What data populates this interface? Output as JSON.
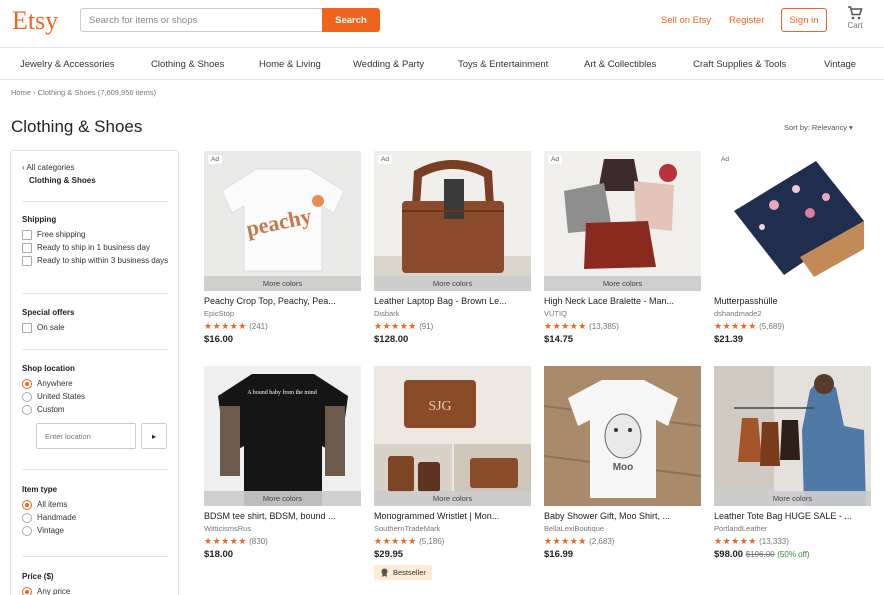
{
  "header": {
    "logo": "Etsy",
    "search_placeholder": "Search for items or shops",
    "search_button": "Search",
    "sell_on_etsy": "Sell on Etsy",
    "register": "Register",
    "sign_in": "Sign in",
    "cart_label": "Cart",
    "cart_icon": "cart-icon"
  },
  "categories": [
    "Jewelry & Accessories",
    "Clothing & Shoes",
    "Home & Living",
    "Wedding & Party",
    "Toys & Entertainment",
    "Art & Collectibles",
    "Craft Supplies & Tools",
    "Vintage"
  ],
  "breadcrumb": "Home › Clothing & Shoes (7,609,956 items)",
  "page_title": "Clothing & Shoes",
  "sort": {
    "label": "Sort by: Relevancy ▾"
  },
  "sidebar": {
    "all_categories": "‹ All categories",
    "current_category": "Clothing & Shoes",
    "shipping": {
      "title": "Shipping",
      "options": [
        "Free shipping",
        "Ready to ship in 1 business day",
        "Ready to ship within 3 business days"
      ]
    },
    "special_offers": {
      "title": "Special offers",
      "options": [
        "On sale"
      ]
    },
    "shop_location": {
      "title": "Shop location",
      "options": [
        "Anywhere",
        "United States",
        "Custom"
      ],
      "selected": "Anywhere",
      "input_placeholder": "Enter location",
      "go_icon": "▸"
    },
    "item_type": {
      "title": "Item type",
      "options": [
        "All items",
        "Handmade",
        "Vintage"
      ],
      "selected": "All items"
    },
    "price": {
      "title": "Price ($)",
      "options": [
        "Any price"
      ],
      "selected": "Any price"
    }
  },
  "products": [
    {
      "ad": "Ad",
      "more_colors": "More colors",
      "title": "Peachy Crop Top, Peachy, Pea...",
      "shop": "EpicStop",
      "stars": "★★★★★",
      "reviews": "(241)",
      "price": "$16.00"
    },
    {
      "ad": "Ad",
      "more_colors": "More colors",
      "title": "Leather Laptop Bag - Brown Le...",
      "shop": "Disbark",
      "stars": "★★★★★",
      "reviews": "(91)",
      "price": "$128.00"
    },
    {
      "ad": "Ad",
      "more_colors": "More colors",
      "title": "High Neck Lace Bralette - Man...",
      "shop": "VUTIQ",
      "stars": "★★★★★",
      "reviews": "(13,385)",
      "price": "$14.75"
    },
    {
      "ad": "Ad",
      "more_colors": "",
      "title": "Mutterpasshülle",
      "shop": "dshandmade2",
      "stars": "★★★★★",
      "reviews": "(5,689)",
      "price": "$21.39"
    },
    {
      "ad": "",
      "more_colors": "More colors",
      "title": "BDSM tee shirt, BDSM, bound ...",
      "shop": "WitticismsRus",
      "stars": "★★★★★",
      "reviews": "(830)",
      "price": "$18.00"
    },
    {
      "ad": "",
      "more_colors": "More colors",
      "title": "Monogrammed Wristlet | Mon...",
      "shop": "SouthernTradeMark",
      "stars": "★★★★★",
      "reviews": "(5,186)",
      "price": "$29.95",
      "badge": "Bestseller"
    },
    {
      "ad": "",
      "more_colors": "",
      "title": "Baby Shower Gift, Moo Shirt, ...",
      "shop": "BellaLexiBoutique",
      "stars": "★★★★★",
      "reviews": "(2,683)",
      "price": "$16.99"
    },
    {
      "ad": "",
      "more_colors": "More colors",
      "title": "Leather Tote Bag HUGE SALE - ...",
      "shop": "PortlandLeather",
      "stars": "★★★★★",
      "reviews": "(13,333)",
      "price": "$98.00",
      "original_price": "$196.00",
      "discount": "(50% off)"
    }
  ],
  "shirt_text": {
    "peachy": "peachy",
    "bdsm": "A bound baby from the mind",
    "moo": "Moo",
    "monogram": "SJG"
  },
  "colors": {
    "accent": "#f1641e",
    "star": "#f1641e",
    "discount": "#3a8b3a"
  }
}
